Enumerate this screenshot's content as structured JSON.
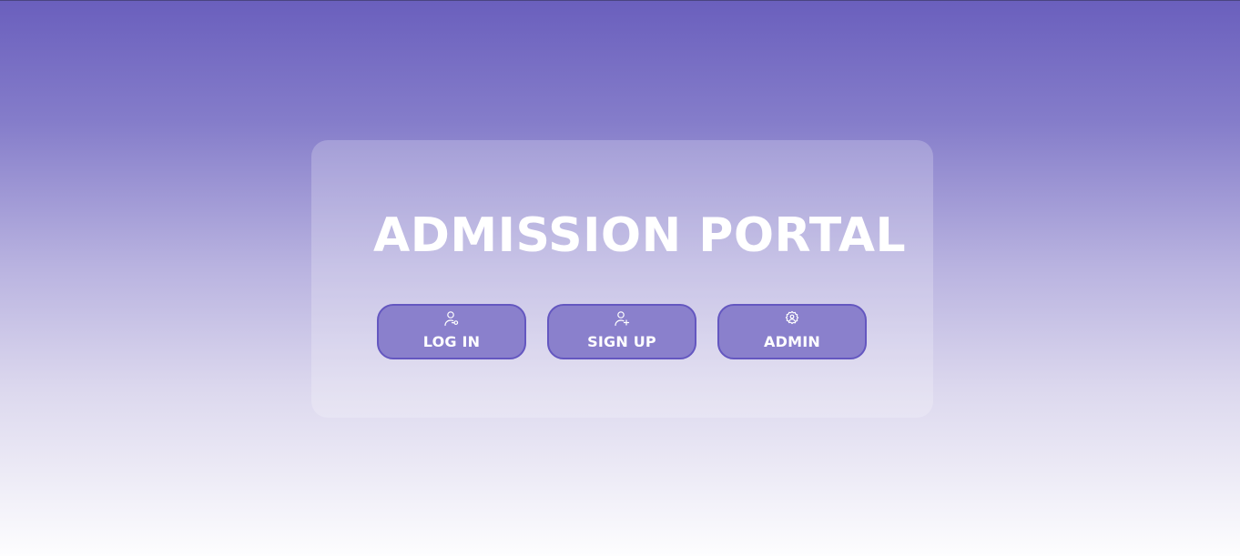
{
  "page": {
    "title": "ADMISSION PORTAL"
  },
  "buttons": {
    "login": {
      "label": "LOG IN",
      "icon": "user-key-icon"
    },
    "signup": {
      "label": "SIGN UP",
      "icon": "user-add-icon"
    },
    "admin": {
      "label": "ADMIN",
      "icon": "user-gear-icon"
    }
  },
  "colors": {
    "gradient_top": "#6a5fbd",
    "gradient_bottom": "#fdfdfe",
    "button_fill": "#8a80cc",
    "button_border": "#6457c0",
    "text": "#ffffff"
  }
}
